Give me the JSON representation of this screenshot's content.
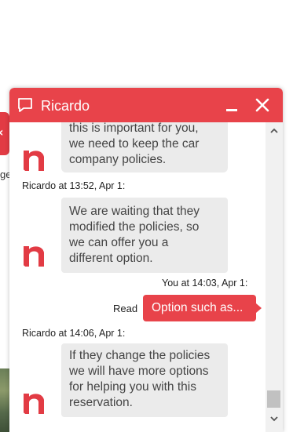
{
  "background": {
    "partial_text": "ge"
  },
  "chat": {
    "title": "Ricardo",
    "icons": {
      "header": "speech-bubble-icon",
      "minimize": "minimize-icon",
      "close": "close-icon",
      "agent_avatar": "brand-h-logo-icon"
    },
    "colors": {
      "accent": "#e8434a",
      "bubble_in": "#ebebeb"
    },
    "messages": [
      {
        "from": "agent",
        "lines": [
          "this is important for you,",
          "we need to keep the car",
          "company policies."
        ]
      },
      {
        "meta": "Ricardo at 13:52, Apr 1:",
        "from": "agent",
        "lines": [
          "We are waiting that they",
          "modified the policies, so",
          "we can offer you a",
          "different option."
        ]
      },
      {
        "meta": "You at 14:03, Apr 1:",
        "from": "user",
        "status": "Read",
        "text": "Option such as..."
      },
      {
        "meta": "Ricardo at 14:06, Apr 1:",
        "from": "agent",
        "lines": [
          "If they change the policies",
          "we will have more options",
          "for helping you with this",
          "reservation."
        ]
      }
    ]
  }
}
